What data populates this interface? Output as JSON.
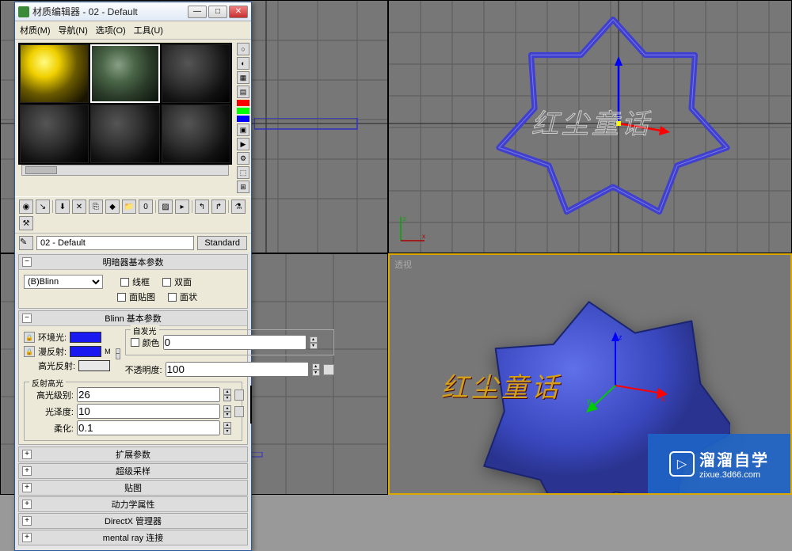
{
  "window": {
    "title": "材质编辑器 - 02 - Default",
    "menus": [
      "材质(M)",
      "导航(N)",
      "选项(O)",
      "工具(U)"
    ]
  },
  "material": {
    "name": "02 - Default",
    "type_btn": "Standard"
  },
  "shader_rollout": {
    "title": "明暗器基本参数",
    "shader": "(B)Blinn",
    "wire": "线框",
    "two_sided": "双面",
    "face_map": "面贴图",
    "faceted": "面状"
  },
  "blinn_rollout": {
    "title": "Blinn 基本参数",
    "ambient": "环境光:",
    "diffuse": "漫反射:",
    "specular": "高光反射:",
    "self_illum_group": "自发光",
    "self_illum_label": "颜色",
    "self_illum_val": "0",
    "opacity_label": "不透明度:",
    "opacity_val": "100",
    "hl_group": "反射高光",
    "spec_level": "高光级别:",
    "spec_level_val": "26",
    "gloss": "光泽度:",
    "gloss_val": "10",
    "soften": "柔化:",
    "soften_val": "0.1",
    "colors": {
      "ambient": "#1a1af0",
      "diffuse": "#1a1af0",
      "specular": "#e8e8e8"
    }
  },
  "collapsed": [
    "扩展参数",
    "超级采样",
    "贴图",
    "动力学属性",
    "DirectX 管理器",
    "mental ray 连接"
  ],
  "viewport": {
    "persp_label": "透视",
    "watermark": "红尘童话"
  },
  "brand": {
    "name": "溜溜自学",
    "url": "zixue.3d66.com"
  }
}
